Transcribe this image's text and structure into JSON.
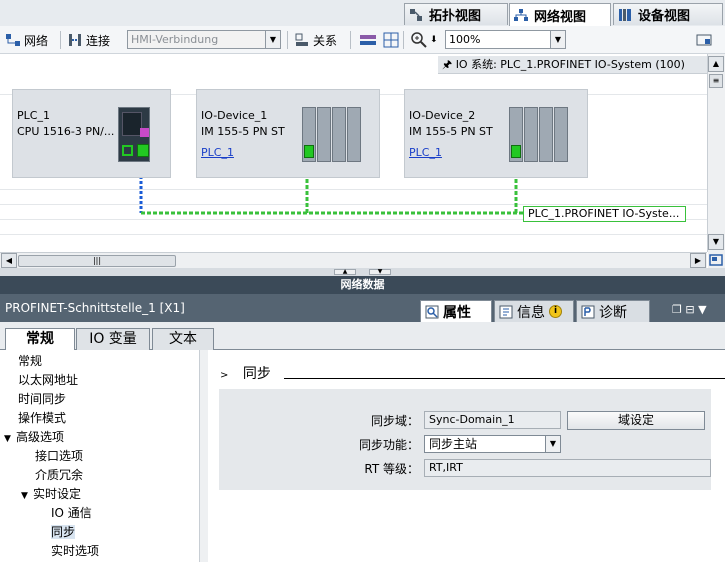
{
  "view_tabs": [
    {
      "label": "拓扑视图",
      "icon": "topology-icon"
    },
    {
      "label": "网络视图",
      "icon": "network-icon",
      "active": true
    },
    {
      "label": "设备视图",
      "icon": "device-icon"
    }
  ],
  "toolbar": {
    "network_label": "网络",
    "connect_label": "连接",
    "connection_type": "HMI-Verbindung",
    "relation_label": "关系",
    "zoom": "100%"
  },
  "canvas": {
    "io_system_label": "IO 系统:",
    "io_system_value": "PLC_1.PROFINET IO-System (100)",
    "network_label": "PLC_1.PROFINET  IO-Syste...",
    "devices": [
      {
        "name": "PLC_1",
        "type": "CPU 1516-3 PN/..."
      },
      {
        "name": "IO-Device_1",
        "type": "IM 155-5 PN ST",
        "link": "PLC_1"
      },
      {
        "name": "IO-Device_2",
        "type": "IM 155-5 PN ST",
        "link": "PLC_1"
      }
    ],
    "colors": {
      "profinet_line": "#39c13b",
      "plc_link": "#1a5bd6"
    }
  },
  "network_data_label": "网络数据",
  "inspector": {
    "title": "PROFINET-Schnittstelle_1 [X1]",
    "tabs": [
      {
        "label": "属性",
        "icon": "properties-icon",
        "active": true
      },
      {
        "label": "信息",
        "icon": "info-icon",
        "badge": "i"
      },
      {
        "label": "诊断",
        "icon": "diagnostics-icon"
      }
    ],
    "subtabs": [
      "常规",
      "IO 变量",
      "文本"
    ]
  },
  "nav": [
    {
      "label": "常规",
      "level": 0
    },
    {
      "label": "以太网地址",
      "level": 0
    },
    {
      "label": "时间同步",
      "level": 0
    },
    {
      "label": "操作模式",
      "level": 0
    },
    {
      "label": "高级选项",
      "level": 0,
      "expanded": true
    },
    {
      "label": "接口选项",
      "level": 1
    },
    {
      "label": "介质冗余",
      "level": 1
    },
    {
      "label": "实时设定",
      "level": 1,
      "expanded": true
    },
    {
      "label": "IO 通信",
      "level": 2
    },
    {
      "label": "同步",
      "level": 2,
      "selected": true
    },
    {
      "label": "实时选项",
      "level": 2
    }
  ],
  "section": {
    "title": "同步",
    "sync_domain_label": "同步域：",
    "sync_domain_value": "Sync-Domain_1",
    "domain_button": "域设定",
    "sync_function_label": "同步功能：",
    "sync_function_value": "同步主站",
    "rt_class_label": "RT 等级：",
    "rt_class_value": "RT,IRT"
  }
}
